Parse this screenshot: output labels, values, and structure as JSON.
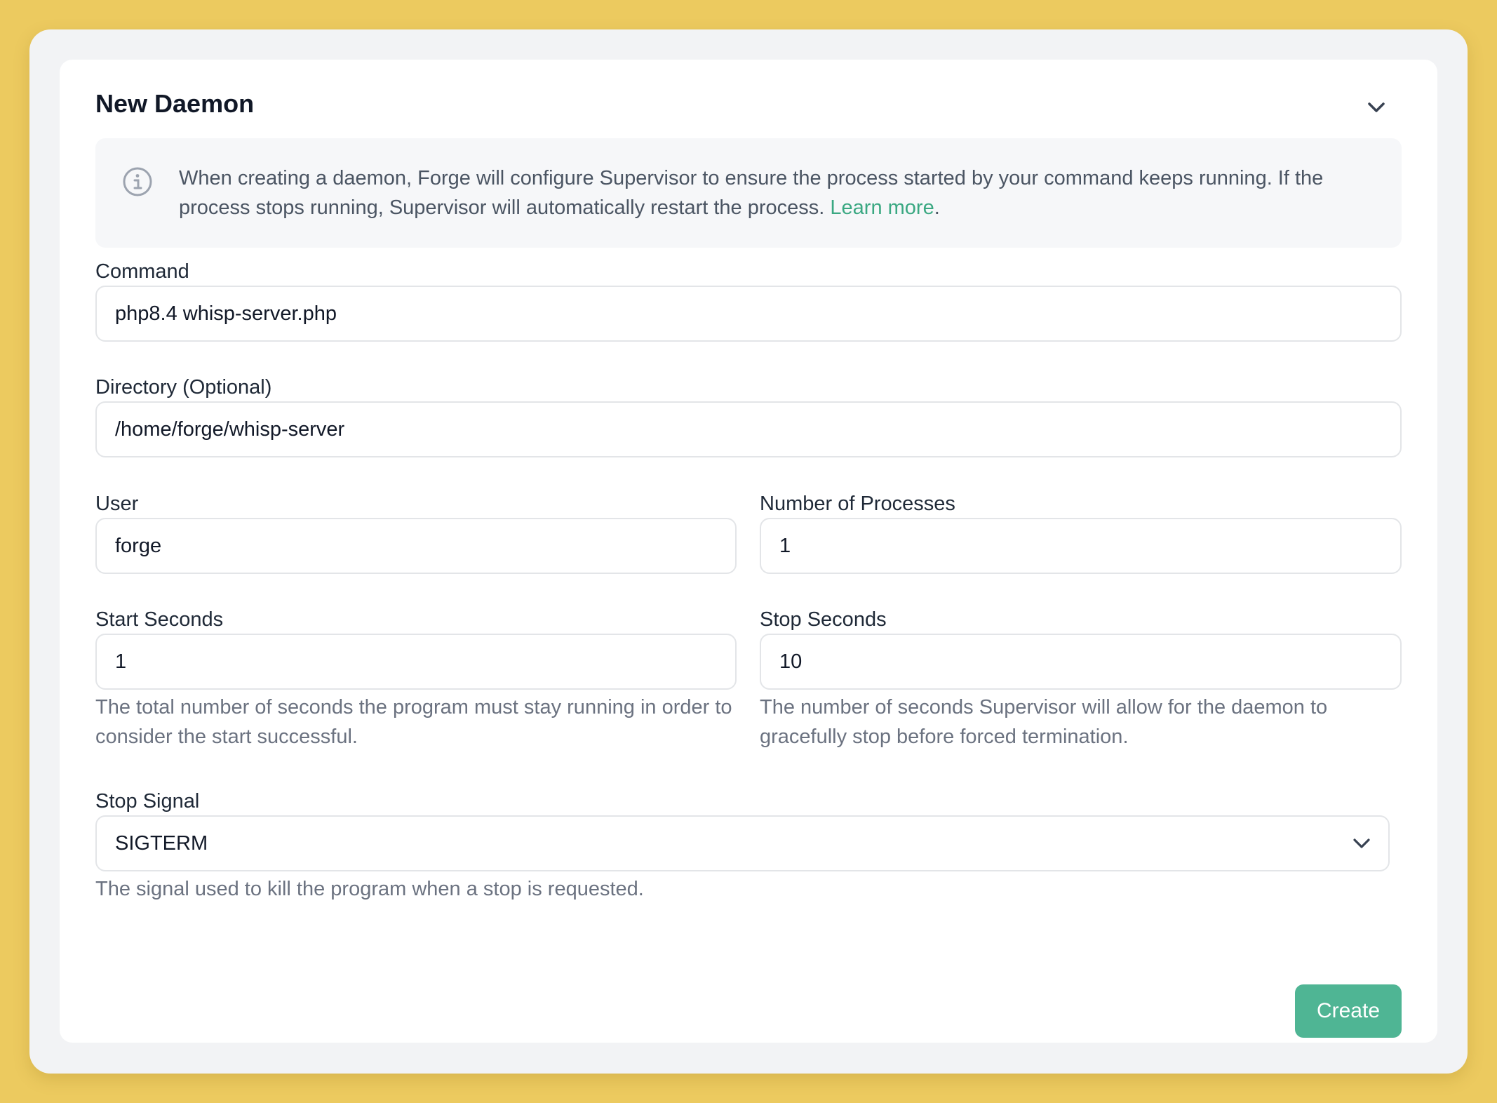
{
  "form": {
    "title": "New Daemon",
    "notice": {
      "text": "When creating a daemon, Forge will configure Supervisor to ensure the process started by your command keeps running. If the process stops running, Supervisor will automatically restart the process.",
      "link_label": "Learn more",
      "suffix": "."
    },
    "command": {
      "label": "Command",
      "value": "php8.4 whisp-server.php"
    },
    "directory": {
      "label": "Directory (Optional)",
      "value": "/home/forge/whisp-server"
    },
    "user": {
      "label": "User",
      "value": "forge"
    },
    "processes": {
      "label": "Number of Processes",
      "value": "1"
    },
    "start_seconds": {
      "label": "Start Seconds",
      "value": "1",
      "help": "The total number of seconds the program must stay running in order to consider the start successful."
    },
    "stop_seconds": {
      "label": "Stop Seconds",
      "value": "10",
      "help": "The number of seconds Supervisor will allow for the daemon to gracefully stop before forced termination."
    },
    "stop_signal": {
      "label": "Stop Signal",
      "value": "SIGTERM",
      "help": "The signal used to kill the program when a stop is requested."
    },
    "submit_label": "Create"
  },
  "icons": {
    "collapse": "chevron-down-icon",
    "info": "info-circle-icon",
    "select": "chevron-down-icon"
  },
  "colors": {
    "background": "#ecca5f",
    "accent": "#4fb594",
    "link": "#3aa882"
  }
}
